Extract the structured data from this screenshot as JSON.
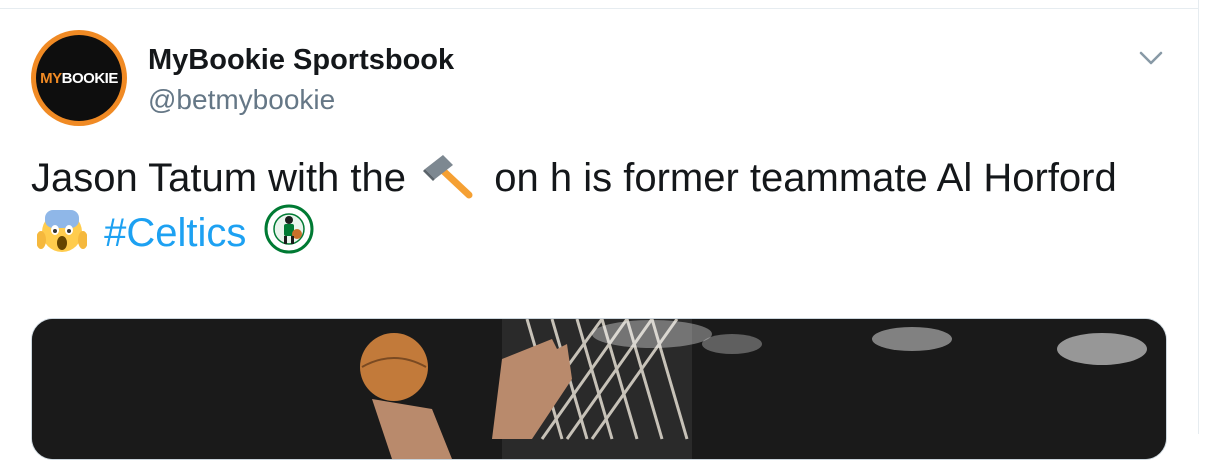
{
  "tweet": {
    "avatar_text_my": "MY",
    "avatar_text_bookie": "BOOKIE",
    "display_name": "MyBookie Sportsbook",
    "handle": "@betmybookie",
    "text_part1": "Jason Tatum with the",
    "text_part2": "on h is former teammate Al Horford",
    "hashtag": "#Celtics"
  },
  "icons": {
    "caret": "chevron-down-icon",
    "hammer": "hammer-emoji",
    "scream": "face-screaming-emoji",
    "logo": "celtics-logo"
  },
  "colors": {
    "hashtag": "#1da1f2",
    "handle": "#657786",
    "avatar_ring": "#f08a24"
  }
}
